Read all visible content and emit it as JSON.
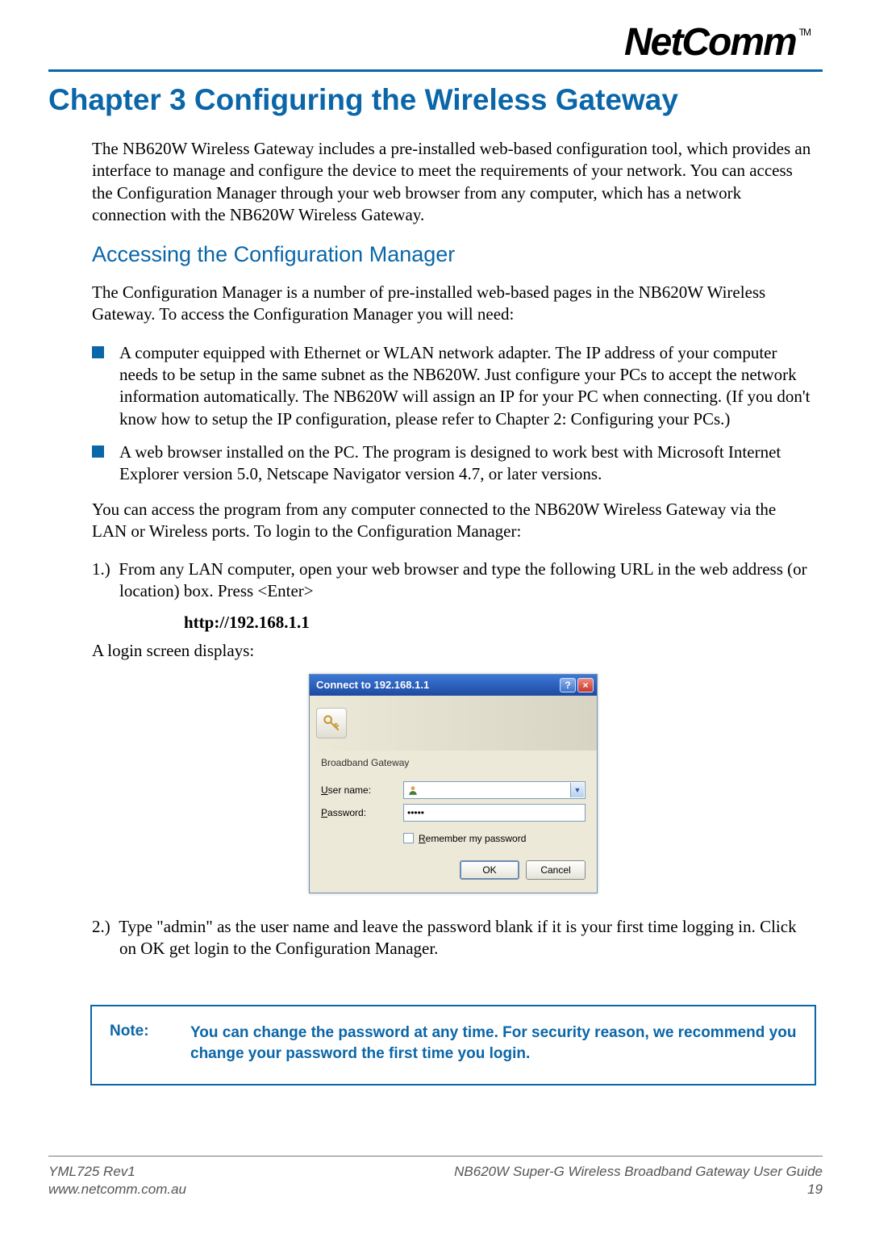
{
  "brand": {
    "name": "NetComm",
    "tm": "TM"
  },
  "chapter": {
    "title": "Chapter 3 Configuring the Wireless Gateway"
  },
  "intro": "The NB620W Wireless Gateway includes a pre-installed web-based configuration tool, which provides an interface to manage and configure the device to meet the requirements of your network. You can access the Configuration Manager through your web browser from any computer, which has a network connection with the NB620W Wireless Gateway.",
  "section": {
    "title": "Accessing the Configuration Manager"
  },
  "section_intro": "The Configuration Manager is a number of pre-installed web-based pages in the NB620W Wireless Gateway. To access the Configuration Manager you will need:",
  "bullets": [
    "A computer equipped with Ethernet or WLAN network adapter. The IP address of your computer needs to be setup in the same subnet as the NB620W. Just configure your PCs to accept the network information automatically. The NB620W will assign an IP for your PC when connecting. (If you don't know how to setup the IP configuration, please refer to Chapter 2: Configuring your PCs.)",
    "A web browser installed on the PC. The program is designed to work best with Microsoft Internet Explorer version 5.0, Netscape Navigator version 4.7, or later versions."
  ],
  "after_bullets": "You can access the program from any computer connected to the NB620W Wireless Gateway via the LAN or Wireless ports. To login to the Configuration Manager:",
  "steps": {
    "one_prefix": "1.)",
    "one_text": "From any LAN computer, open your web browser and type the following URL in the web address (or location) box.  Press <Enter>",
    "url": "http://192.168.1.1",
    "login_caption": "A login screen displays:",
    "two_prefix": "2.)",
    "two_text": "Type \"admin\" as the user name and leave the password blank if it is your first time logging in. Click on OK get login to the Configuration Manager."
  },
  "dialog": {
    "title": "Connect to 192.168.1.1",
    "help": "?",
    "close": "×",
    "realm": "Broadband Gateway",
    "username_label_u": "U",
    "username_label_rest": "ser name:",
    "password_label_u": "P",
    "password_label_rest": "assword:",
    "username_value": "",
    "password_value": "•••••",
    "remember_u": "R",
    "remember_rest": "emember my password",
    "ok": "OK",
    "cancel": "Cancel"
  },
  "note": {
    "label": "Note:",
    "text": "You can change the password at any time. For security reason, we recommend you change your password the first time you login."
  },
  "footer": {
    "rev": "YML725 Rev1",
    "site": "www.netcomm.com.au",
    "doc": "NB620W Super-G Wireless Broadband  Gateway User Guide",
    "page": "19"
  }
}
